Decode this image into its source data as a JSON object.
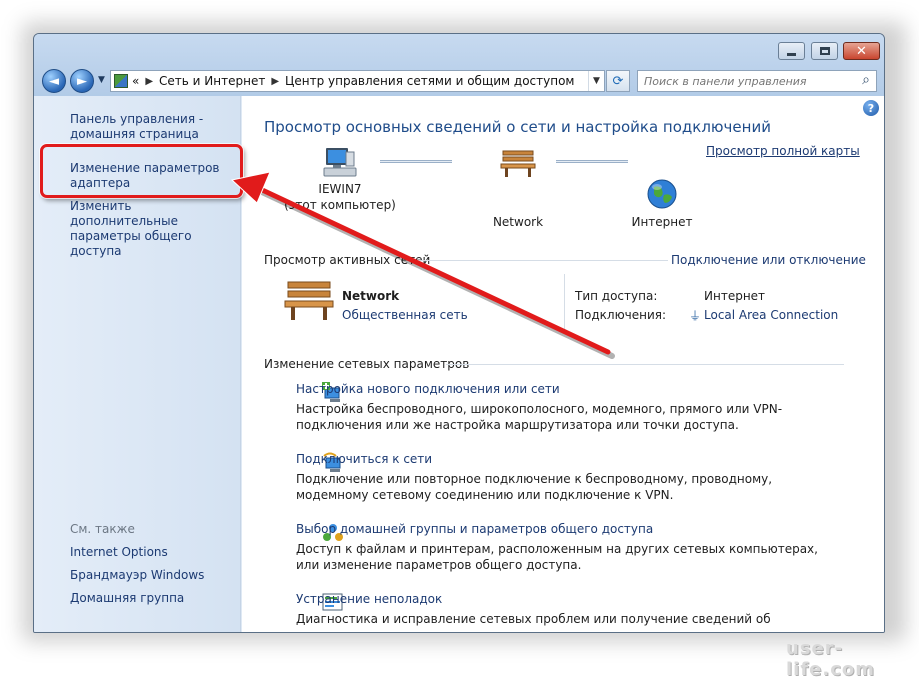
{
  "window": {
    "captions": {
      "minimize": "─",
      "maximize": "□",
      "close": "✕"
    }
  },
  "nav": {
    "back_glyph": "◄",
    "forward_glyph": "►",
    "history_glyph": "▼",
    "breadcrumbs": [
      "«",
      "Сеть и Интернет",
      "Центр управления сетями и общим доступом"
    ],
    "dropdown_glyph": "▼",
    "refresh_glyph": "⟳",
    "search_placeholder": "Поиск в панели управления",
    "search_glyph": "⌕"
  },
  "sidebar": {
    "home": "Панель управления - домашняя страница",
    "adapter": "Изменение параметров адаптера",
    "sharing": "Изменить дополнительные параметры общего доступа",
    "see_also_title": "См. также",
    "see_also": [
      "Internet Options",
      "Брандмауэр Windows",
      "Домашняя группа"
    ]
  },
  "main": {
    "help_glyph": "?",
    "title": "Просмотр основных сведений о сети и настройка подключений",
    "full_map": "Просмотр полной карты",
    "map": {
      "computer_name": "IEWIN7",
      "computer_sub": "(этот компьютер)",
      "network": "Network",
      "internet": "Интернет"
    },
    "active": {
      "title": "Просмотр активных сетей",
      "connect_link": "Подключение или отключение",
      "network_name": "Network",
      "network_type": "Общественная сеть",
      "access_label": "Тип доступа:",
      "access_value": "Интернет",
      "connections_label": "Подключения:",
      "connections_value": "Local Area Connection"
    },
    "change": {
      "title": "Изменение сетевых параметров",
      "tasks": [
        {
          "link": "Настройка нового подключения или сети",
          "desc": "Настройка беспроводного, широкополосного, модемного, прямого или VPN-подключения или же настройка маршрутизатора или точки доступа."
        },
        {
          "link": "Подключиться к сети",
          "desc": "Подключение или повторное подключение к беспроводному, проводному, модемному сетевому соединению или подключение к VPN."
        },
        {
          "link": "Выбор домашней группы и параметров общего доступа",
          "desc": "Доступ к файлам и принтерам, расположенным на других сетевых компьютерах, или изменение параметров общего доступа."
        },
        {
          "link": "Устранение неполадок",
          "desc": "Диагностика и исправление сетевых проблем или получение сведений об исправлении."
        }
      ]
    }
  },
  "watermark": "user-life.com",
  "colors": {
    "link": "#1c3a72",
    "title": "#1f4c8a",
    "annotation": "#e11b1b"
  }
}
